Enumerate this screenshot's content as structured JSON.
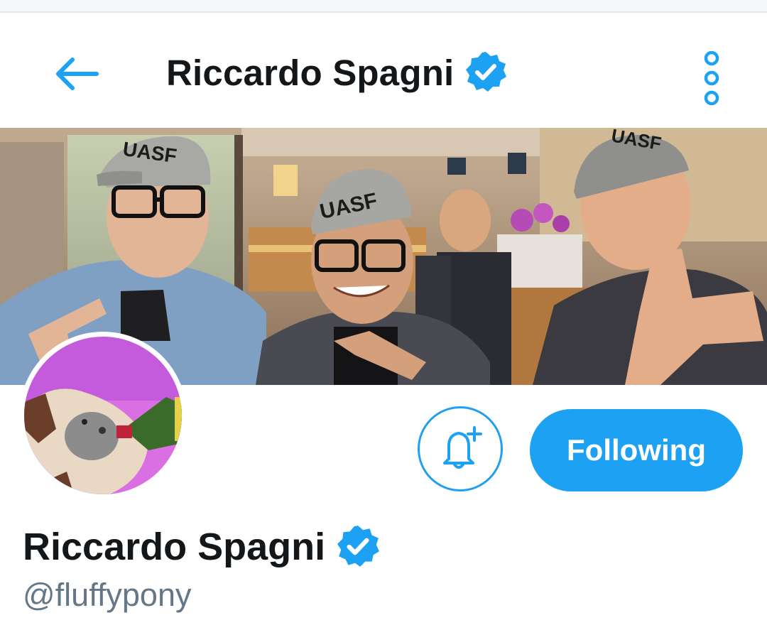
{
  "header": {
    "title": "Riccardo Spagni",
    "back_icon": "arrow-left-icon",
    "menu_icon": "more-vertical-icon",
    "verified_icon": "verified-badge-icon"
  },
  "banner": {
    "cap_text_left": "UASF",
    "cap_text_center": "UASF",
    "cap_text_right": "UASF"
  },
  "profile": {
    "name": "Riccardo Spagni",
    "handle": "@fluffypony",
    "verified": true
  },
  "actions": {
    "notifications_icon": "bell-plus-icon",
    "follow_label": "Following"
  },
  "colors": {
    "accent": "#1da1f2",
    "text_primary": "#14171a",
    "text_secondary": "#657786"
  }
}
